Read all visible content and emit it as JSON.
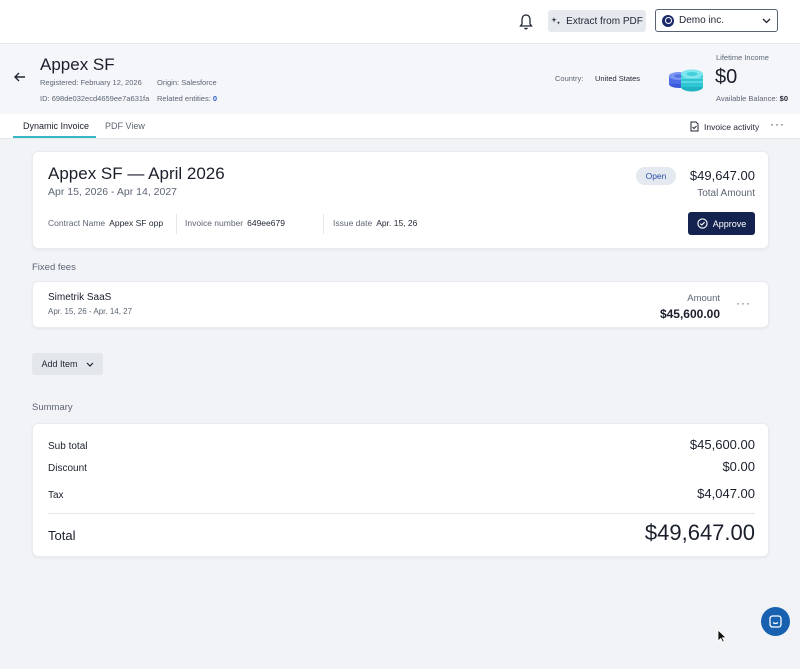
{
  "topbar": {
    "extract_label": "Extract from PDF",
    "org_name": "Demo inc."
  },
  "header": {
    "entity_name": "Appex SF",
    "registered_label": "Registered:",
    "registered_value": "February 12, 2026",
    "origin_label": "Origin:",
    "origin_value": "Salesforce",
    "id_label": "ID:",
    "id_value": "698de032ecd4659ee7a631fa",
    "related_label": "Related entities:",
    "related_value": "0",
    "country_label": "Country:",
    "country_value": "United States",
    "lifetime_label": "Lifetime Income",
    "lifetime_value": "$0",
    "available_label": "Available Balance:",
    "available_value": "$0"
  },
  "tabs": {
    "items": [
      {
        "label": "Dynamic Invoice",
        "active": true
      },
      {
        "label": "PDF View",
        "active": false
      }
    ],
    "activity_label": "Invoice activity",
    "more_label": "···"
  },
  "invoice": {
    "title": "Appex SF — April 2026",
    "period": "Apr 15, 2026 - Apr 14, 2027",
    "status": "Open",
    "total_amount": "$49,647.00",
    "total_label": "Total Amount",
    "contract_label": "Contract Name",
    "contract_value": "Appex SF opp",
    "invoice_number_label": "Invoice number",
    "invoice_number_value": "649ee679",
    "issue_date_label": "Issue date",
    "issue_date_value": "Apr. 15, 26",
    "approve_label": "Approve"
  },
  "fixed_fees": {
    "section_label": "Fixed fees",
    "items": [
      {
        "name": "Simetrik SaaS",
        "period": "Apr. 15, 26 - Apr. 14, 27",
        "amount_label": "Amount",
        "amount": "$45,600.00",
        "more_label": "···"
      }
    ],
    "add_item_label": "Add Item"
  },
  "summary": {
    "section_label": "Summary",
    "rows": [
      {
        "label": "Sub total",
        "value": "$45,600.00"
      },
      {
        "label": "Discount",
        "value": "$0.00"
      },
      {
        "label": "Tax",
        "value": "$4,047.00"
      }
    ],
    "total_label": "Total",
    "total_value": "$49,647.00"
  },
  "colors": {
    "primary_dark": "#14224f",
    "tab_accent": "#3ab7c6",
    "link_blue": "#2c5cc5",
    "chat_blue": "#1761b0"
  },
  "icons": [
    "bell-icon",
    "sparkle-icon",
    "org-avatar-icon",
    "chevron-down-icon",
    "back-arrow-icon",
    "coins-icon",
    "document-icon",
    "check-circle-icon",
    "chat-icon",
    "cursor-icon"
  ]
}
